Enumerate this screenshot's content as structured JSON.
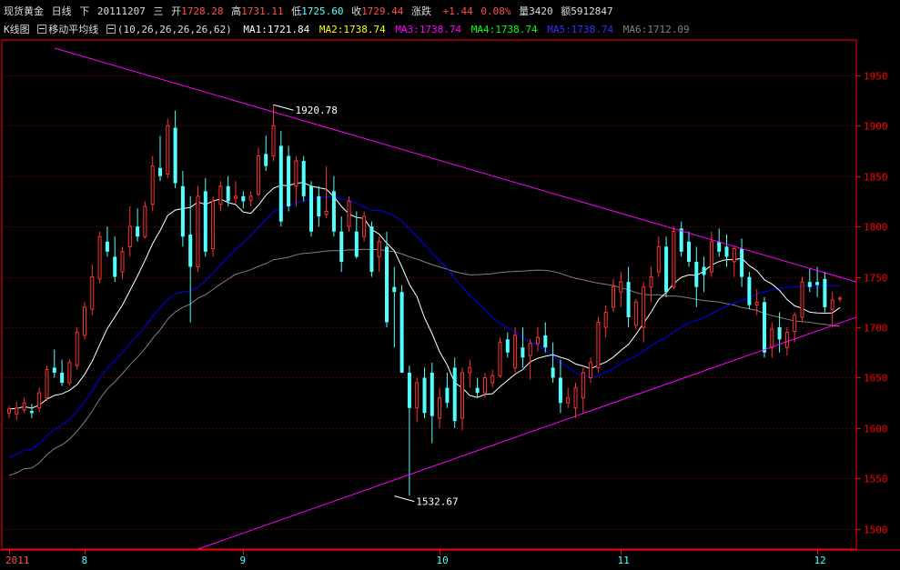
{
  "header": {
    "instrument": "现货黄金",
    "period": "日线",
    "direction": "下",
    "date": "20111207",
    "weekday": "三",
    "open_label": "开",
    "open": "1728.28",
    "high_label": "高",
    "high": "1731.11",
    "low_label": "低",
    "low": "1725.60",
    "close_label": "收",
    "close": "1729.44",
    "change_label": "涨跌",
    "change": "+1.44",
    "change_pct": "0.08%",
    "volume_label": "量",
    "volume": "3420",
    "amount_label": "额",
    "amount": "5912847"
  },
  "indicator": {
    "kline_label": "K线图",
    "ma_label": "移动平均线",
    "ma_params": "(10,26,26,26,26,62)",
    "ma": [
      {
        "label": "MA1:",
        "value": "1721.84",
        "color": "#ffffff"
      },
      {
        "label": "MA2:",
        "value": "1738.74",
        "color": "#ffff00"
      },
      {
        "label": "MA3:",
        "value": "1738.74",
        "color": "#ff00ff"
      },
      {
        "label": "MA4:",
        "value": "1738.74",
        "color": "#00ff00"
      },
      {
        "label": "MA5:",
        "value": "1738.74",
        "color": "#3333ff"
      },
      {
        "label": "MA6:",
        "value": "1712.09",
        "color": "#808080"
      }
    ]
  },
  "colors": {
    "up": "#ff3232",
    "down": "#54ffff",
    "grid": "#a00000",
    "axis": "#ff0000",
    "trendline": "#ff00ff",
    "ma1": "#ffffff",
    "ma5": "#0000ff",
    "ma6": "#808080"
  },
  "chart_data": {
    "type": "candlestick",
    "ylim": [
      1480,
      1985
    ],
    "yticks": [
      1500,
      1550,
      1600,
      1650,
      1700,
      1750,
      1800,
      1850,
      1900,
      1950
    ],
    "xticks": [
      {
        "label": "2011",
        "index": 0
      },
      {
        "label": "8",
        "index": 10
      },
      {
        "label": "9",
        "index": 31
      },
      {
        "label": "10",
        "index": 57
      },
      {
        "label": "11",
        "index": 81
      },
      {
        "label": "12",
        "index": 107
      }
    ],
    "annotations": [
      {
        "text": "1920.78",
        "index": 35,
        "value": 1920.78
      },
      {
        "text": "1532.67",
        "index": 51,
        "value": 1532.67
      }
    ],
    "candles": [
      [
        1615,
        1622,
        1610,
        1619
      ],
      [
        1614,
        1626,
        1608,
        1620
      ],
      [
        1618,
        1630,
        1615,
        1625
      ],
      [
        1617,
        1624,
        1610,
        1615
      ],
      [
        1620,
        1640,
        1616,
        1635
      ],
      [
        1630,
        1662,
        1627,
        1658
      ],
      [
        1660,
        1678,
        1650,
        1655
      ],
      [
        1655,
        1668,
        1642,
        1645
      ],
      [
        1645,
        1668,
        1642,
        1665
      ],
      [
        1662,
        1700,
        1658,
        1695
      ],
      [
        1692,
        1725,
        1688,
        1720
      ],
      [
        1718,
        1762,
        1712,
        1750
      ],
      [
        1748,
        1795,
        1744,
        1790
      ],
      [
        1785,
        1800,
        1770,
        1775
      ],
      [
        1770,
        1790,
        1745,
        1750
      ],
      [
        1755,
        1780,
        1748,
        1775
      ],
      [
        1780,
        1820,
        1770,
        1800
      ],
      [
        1800,
        1818,
        1785,
        1790
      ],
      [
        1790,
        1825,
        1788,
        1820
      ],
      [
        1822,
        1870,
        1815,
        1860
      ],
      [
        1858,
        1890,
        1845,
        1850
      ],
      [
        1852,
        1907,
        1848,
        1900
      ],
      [
        1898,
        1915,
        1838,
        1843
      ],
      [
        1840,
        1855,
        1780,
        1790
      ],
      [
        1792,
        1830,
        1705,
        1760
      ],
      [
        1760,
        1840,
        1755,
        1830
      ],
      [
        1835,
        1848,
        1770,
        1775
      ],
      [
        1778,
        1830,
        1770,
        1825
      ],
      [
        1822,
        1845,
        1815,
        1840
      ],
      [
        1840,
        1850,
        1820,
        1825
      ],
      [
        1828,
        1845,
        1822,
        1830
      ],
      [
        1830,
        1835,
        1818,
        1825
      ],
      [
        1826,
        1835,
        1820,
        1830
      ],
      [
        1832,
        1878,
        1830,
        1870
      ],
      [
        1872,
        1890,
        1855,
        1860
      ],
      [
        1870,
        1921,
        1865,
        1900
      ],
      [
        1880,
        1895,
        1800,
        1805
      ],
      [
        1870,
        1880,
        1815,
        1820
      ],
      [
        1840,
        1870,
        1820,
        1865
      ],
      [
        1865,
        1870,
        1825,
        1830
      ],
      [
        1840,
        1845,
        1790,
        1795
      ],
      [
        1830,
        1840,
        1800,
        1810
      ],
      [
        1812,
        1860,
        1808,
        1815
      ],
      [
        1835,
        1850,
        1790,
        1795
      ],
      [
        1795,
        1810,
        1755,
        1765
      ],
      [
        1800,
        1830,
        1795,
        1825
      ],
      [
        1795,
        1815,
        1768,
        1770
      ],
      [
        1790,
        1815,
        1785,
        1810
      ],
      [
        1800,
        1805,
        1750,
        1755
      ],
      [
        1770,
        1790,
        1755,
        1785
      ],
      [
        1780,
        1795,
        1700,
        1705
      ],
      [
        1740,
        1760,
        1680,
        1735
      ],
      [
        1735,
        1742,
        1655,
        1655
      ],
      [
        1655,
        1662,
        1533,
        1620
      ],
      [
        1620,
        1650,
        1606,
        1645
      ],
      [
        1650,
        1660,
        1610,
        1615
      ],
      [
        1655,
        1665,
        1585,
        1612
      ],
      [
        1610,
        1640,
        1600,
        1630
      ],
      [
        1640,
        1655,
        1620,
        1625
      ],
      [
        1660,
        1670,
        1600,
        1607
      ],
      [
        1610,
        1660,
        1598,
        1655
      ],
      [
        1655,
        1668,
        1640,
        1660
      ],
      [
        1640,
        1650,
        1630,
        1635
      ],
      [
        1635,
        1655,
        1630,
        1650
      ],
      [
        1645,
        1658,
        1640,
        1652
      ],
      [
        1652,
        1690,
        1650,
        1685
      ],
      [
        1688,
        1695,
        1670,
        1675
      ],
      [
        1660,
        1700,
        1655,
        1692
      ],
      [
        1680,
        1700,
        1660,
        1670
      ],
      [
        1672,
        1688,
        1648,
        1684
      ],
      [
        1684,
        1700,
        1676,
        1690
      ],
      [
        1692,
        1705,
        1675,
        1680
      ],
      [
        1660,
        1685,
        1645,
        1650
      ],
      [
        1650,
        1668,
        1615,
        1625
      ],
      [
        1625,
        1640,
        1620,
        1630
      ],
      [
        1620,
        1645,
        1610,
        1640
      ],
      [
        1630,
        1660,
        1615,
        1655
      ],
      [
        1650,
        1670,
        1645,
        1665
      ],
      [
        1660,
        1710,
        1655,
        1705
      ],
      [
        1700,
        1722,
        1690,
        1715
      ],
      [
        1720,
        1748,
        1715,
        1740
      ],
      [
        1735,
        1755,
        1720,
        1745
      ],
      [
        1745,
        1760,
        1700,
        1710
      ],
      [
        1702,
        1728,
        1698,
        1725
      ],
      [
        1700,
        1745,
        1685,
        1740
      ],
      [
        1740,
        1760,
        1725,
        1750
      ],
      [
        1755,
        1790,
        1750,
        1780
      ],
      [
        1780,
        1790,
        1730,
        1735
      ],
      [
        1740,
        1800,
        1738,
        1795
      ],
      [
        1798,
        1805,
        1770,
        1775
      ],
      [
        1785,
        1795,
        1760,
        1765
      ],
      [
        1765,
        1780,
        1720,
        1740
      ],
      [
        1760,
        1770,
        1735,
        1752
      ],
      [
        1755,
        1795,
        1750,
        1785
      ],
      [
        1785,
        1798,
        1770,
        1775
      ],
      [
        1780,
        1792,
        1760,
        1770
      ],
      [
        1765,
        1780,
        1750,
        1778
      ],
      [
        1778,
        1788,
        1740,
        1750
      ],
      [
        1750,
        1755,
        1718,
        1722
      ],
      [
        1722,
        1738,
        1712,
        1725
      ],
      [
        1725,
        1730,
        1670,
        1675
      ],
      [
        1680,
        1705,
        1670,
        1698
      ],
      [
        1700,
        1715,
        1675,
        1688
      ],
      [
        1680,
        1700,
        1672,
        1695
      ],
      [
        1696,
        1715,
        1685,
        1712
      ],
      [
        1710,
        1750,
        1705,
        1745
      ],
      [
        1745,
        1758,
        1735,
        1740
      ],
      [
        1745,
        1760,
        1730,
        1742
      ],
      [
        1748,
        1755,
        1715,
        1720
      ],
      [
        1718,
        1735,
        1700,
        1727
      ],
      [
        1728,
        1731,
        1725,
        1729
      ]
    ],
    "trendlines": [
      {
        "from": {
          "index": 6,
          "value": 1977
        },
        "to": {
          "index": "end",
          "value": 1745
        }
      },
      {
        "from": {
          "index": 25,
          "value": 1480
        },
        "to": {
          "index": "end",
          "value": 1710
        }
      }
    ]
  }
}
